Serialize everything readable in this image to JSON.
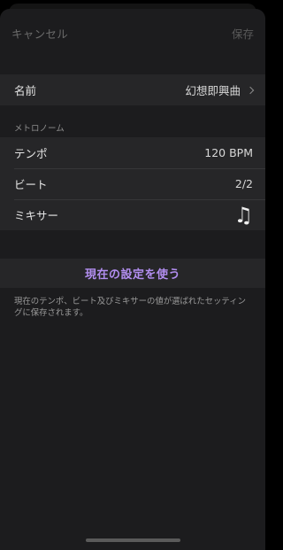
{
  "nav": {
    "cancel_label": "キャンセル",
    "save_label": "保存"
  },
  "name_row": {
    "label": "名前",
    "value": "幻想即興曲"
  },
  "metronome": {
    "section_title": "メトロノーム",
    "tempo_label": "テンポ",
    "tempo_value": "120 BPM",
    "beat_label": "ビート",
    "beat_value": "2/2",
    "mixer_label": "ミキサー",
    "mixer_icon": "music-note-icon",
    "mixer_glyph": "♫"
  },
  "action": {
    "use_current_label": "現在の設定を使う",
    "footnote": "現在のテンポ、ビート及びミキサーの値が選ばれたセッティングに保存されます。"
  },
  "colors": {
    "accent": "#b28ef0",
    "sheet_background": "#1c1c1e",
    "cell_background": "#262628"
  }
}
